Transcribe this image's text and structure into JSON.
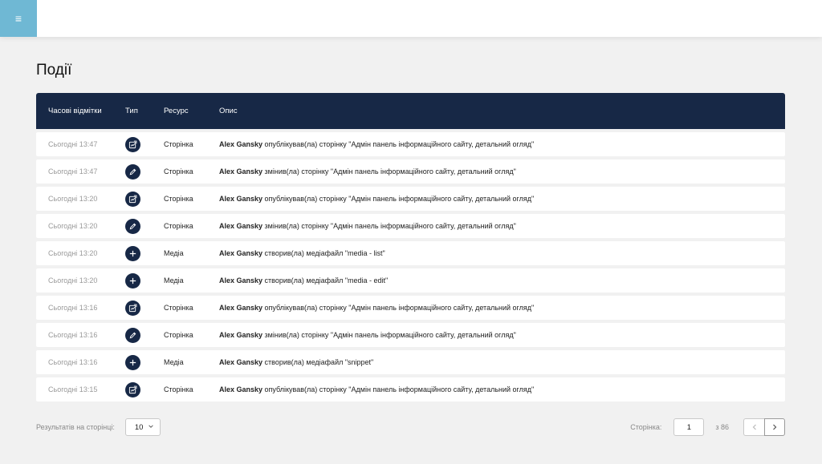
{
  "header": {
    "menu_icon": "hamburger-icon",
    "menu_glyph": "≡"
  },
  "page": {
    "title": "Події"
  },
  "table": {
    "columns": {
      "time": "Часові відмітки",
      "type": "Тип",
      "resource": "Ресурс",
      "description": "Опис"
    },
    "rows": [
      {
        "time": "Сьогодні 13:47",
        "type_icon": "publish-icon",
        "resource": "Сторінка",
        "user": "Alex Gansky",
        "action": " опублікував(ла) сторінку \"Адмін панель інформаційного сайту, детальний огляд\""
      },
      {
        "time": "Сьогодні 13:47",
        "type_icon": "edit-icon",
        "resource": "Сторінка",
        "user": "Alex Gansky",
        "action": " змінив(ла) сторінку \"Адмін панель інформаційного сайту, детальний огляд\""
      },
      {
        "time": "Сьогодні 13:20",
        "type_icon": "publish-icon",
        "resource": "Сторінка",
        "user": "Alex Gansky",
        "action": " опублікував(ла) сторінку \"Адмін панель інформаційного сайту, детальний огляд\""
      },
      {
        "time": "Сьогодні 13:20",
        "type_icon": "edit-icon",
        "resource": "Сторінка",
        "user": "Alex Gansky",
        "action": " змінив(ла) сторінку \"Адмін панель інформаційного сайту, детальний огляд\""
      },
      {
        "time": "Сьогодні 13:20",
        "type_icon": "plus-icon",
        "resource": "Медіа",
        "user": "Alex Gansky",
        "action": " створив(ла) медіафайл \"media - list\""
      },
      {
        "time": "Сьогодні 13:20",
        "type_icon": "plus-icon",
        "resource": "Медіа",
        "user": "Alex Gansky",
        "action": " створив(ла) медіафайл \"media - edit\""
      },
      {
        "time": "Сьогодні 13:16",
        "type_icon": "publish-icon",
        "resource": "Сторінка",
        "user": "Alex Gansky",
        "action": " опублікував(ла) сторінку \"Адмін панель інформаційного сайту, детальний огляд\""
      },
      {
        "time": "Сьогодні 13:16",
        "type_icon": "edit-icon",
        "resource": "Сторінка",
        "user": "Alex Gansky",
        "action": " змінив(ла) сторінку \"Адмін панель інформаційного сайту, детальний огляд\""
      },
      {
        "time": "Сьогодні 13:16",
        "type_icon": "plus-icon",
        "resource": "Медіа",
        "user": "Alex Gansky",
        "action": " створив(ла) медіафайл \"snippet\""
      },
      {
        "time": "Сьогодні 13:15",
        "type_icon": "publish-icon",
        "resource": "Сторінка",
        "user": "Alex Gansky",
        "action": " опублікував(ла) сторінку \"Адмін панель інформаційного сайту, детальний огляд\""
      }
    ]
  },
  "pagination": {
    "per_page_label": "Результатів на сторінці:",
    "per_page_value": "10",
    "page_label": "Сторінка:",
    "page_value": "1",
    "of_total": "з 86"
  },
  "colors": {
    "accent": "#6fb8d4",
    "header_bg": "#172846",
    "background": "#f1f1f1"
  }
}
